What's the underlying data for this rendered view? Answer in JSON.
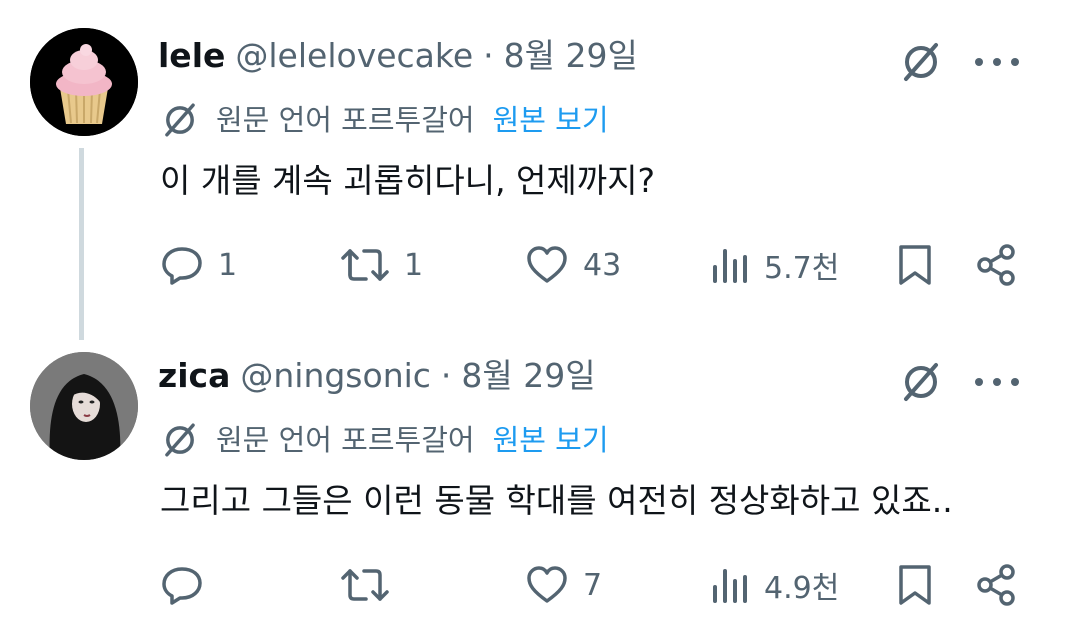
{
  "tweets": [
    {
      "display_name": "lele",
      "handle": "@lelelovecake",
      "separator": "·",
      "date": "8월 29일",
      "translate_note": "원문 언어 포르투갈어",
      "translate_link": "원본 보기",
      "text": "이 개를 계속 괴롭히다니, 언제까지?",
      "replies": "1",
      "retweets": "1",
      "likes": "43",
      "views": "5.7천",
      "avatar": "cupcake-avatar"
    },
    {
      "display_name": "zica",
      "handle": "@ningsonic",
      "separator": "·",
      "date": "8월 29일",
      "translate_note": "원문 언어 포르투갈어",
      "translate_link": "원본 보기",
      "text": "그리고 그들은 이런 동물 학대를 여전히 정상화하고 있죠..",
      "replies": "",
      "retweets": "",
      "likes": "7",
      "views": "4.9천",
      "avatar": "person-avatar"
    }
  ],
  "icons": {
    "top": [
      "grok-icon",
      "more-options-icon"
    ],
    "actions": [
      "reply-icon",
      "retweet-icon",
      "like-icon",
      "views-icon",
      "bookmark-icon",
      "share-icon"
    ]
  },
  "colors": {
    "text": "#0f1419",
    "secondary": "#536471",
    "link": "#1d9bf0",
    "thread_line": "#cfd9de"
  }
}
